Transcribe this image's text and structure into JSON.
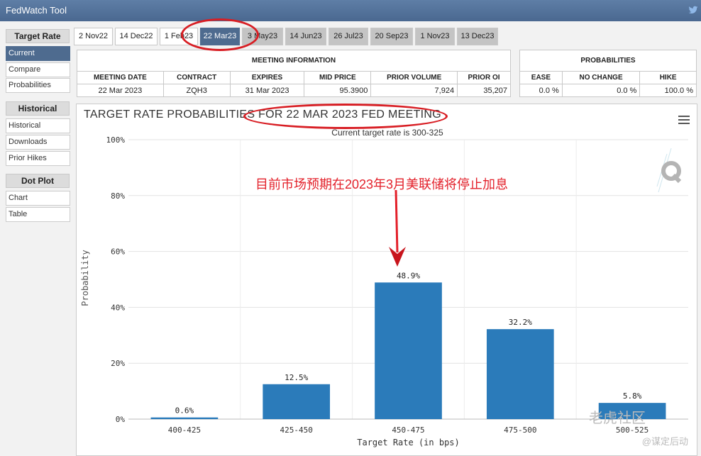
{
  "app": {
    "title": "FedWatch Tool"
  },
  "sidebar": {
    "sections": [
      {
        "label": "Target Rate",
        "items": [
          {
            "label": "Current",
            "active": true
          },
          {
            "label": "Compare"
          },
          {
            "label": "Probabilities"
          }
        ]
      },
      {
        "label": "Historical",
        "items": [
          {
            "label": "Historical"
          },
          {
            "label": "Downloads"
          },
          {
            "label": "Prior Hikes"
          }
        ]
      },
      {
        "label": "Dot Plot",
        "items": [
          {
            "label": "Chart"
          },
          {
            "label": "Table"
          }
        ]
      }
    ]
  },
  "tabs": [
    {
      "label": "2 Nov22"
    },
    {
      "label": "14 Dec22"
    },
    {
      "label": "1 Feb23"
    },
    {
      "label": "22 Mar23",
      "active": true
    },
    {
      "label": "3 May23"
    },
    {
      "label": "14 Jun23"
    },
    {
      "label": "26 Jul23"
    },
    {
      "label": "20 Sep23"
    },
    {
      "label": "1 Nov23"
    },
    {
      "label": "13 Dec23"
    }
  ],
  "meeting_info": {
    "title": "MEETING INFORMATION",
    "headers": [
      "MEETING DATE",
      "CONTRACT",
      "EXPIRES",
      "MID PRICE",
      "PRIOR VOLUME",
      "PRIOR OI"
    ],
    "values": [
      "22 Mar 2023",
      "ZQH3",
      "31 Mar 2023",
      "95.3900",
      "7,924",
      "35,207"
    ]
  },
  "probabilities": {
    "title": "PROBABILITIES",
    "headers": [
      "EASE",
      "NO CHANGE",
      "HIKE"
    ],
    "values": [
      "0.0 %",
      "0.0 %",
      "100.0 %"
    ]
  },
  "chart_data": {
    "type": "bar",
    "title": "TARGET RATE PROBABILITIES FOR 22 MAR 2023 FED MEETING",
    "subtitle": "Current target rate is 300-325",
    "xlabel": "Target Rate (in bps)",
    "ylabel": "Probability",
    "categories": [
      "400-425",
      "425-450",
      "450-475",
      "475-500",
      "500-525"
    ],
    "values": [
      0.6,
      12.5,
      48.9,
      32.2,
      5.8
    ],
    "data_labels": [
      "0.6%",
      "12.5%",
      "48.9%",
      "32.2%",
      "5.8%"
    ],
    "ylim": [
      0,
      100
    ],
    "yticks": [
      0,
      20,
      40,
      60,
      80,
      100
    ],
    "ytick_labels": [
      "0%",
      "20%",
      "40%",
      "60%",
      "80%",
      "100%"
    ],
    "grid": true,
    "bar_color": "#2b7bba"
  },
  "annotation": {
    "text": "目前市场预期在2023年3月美联储将停止加息",
    "color": "#e3202a"
  },
  "watermark": {
    "main": "老虎社区",
    "sub": "@谋定后动"
  },
  "icons": {
    "menu": "hamburger-menu-icon",
    "logo": "q-logo-icon",
    "share": "bird-icon"
  }
}
